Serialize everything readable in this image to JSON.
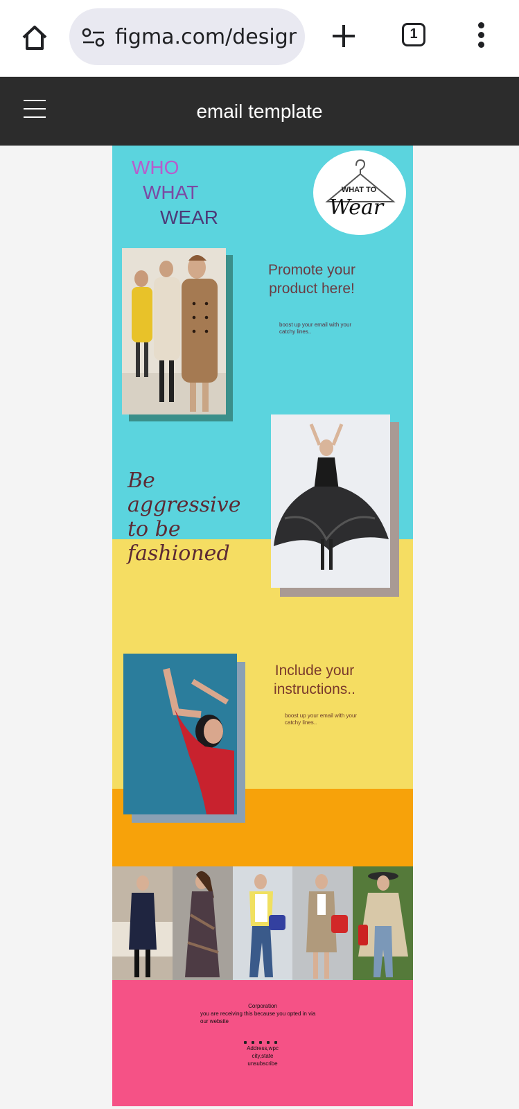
{
  "browser": {
    "url": "figma.com/design/",
    "tab_count": "1"
  },
  "figma": {
    "title": "email template"
  },
  "email": {
    "wordmark": [
      "WHO",
      "WHAT",
      "WEAR"
    ],
    "logo": {
      "line1": "WHAT TO",
      "line2": "Wear"
    },
    "promo": {
      "title": "Promote your product here!",
      "body": "boost up your  email with your catchy lines.."
    },
    "tagline": [
      "Be",
      "aggressive",
      "to be",
      "fashioned"
    ],
    "instructions": {
      "title": "Include your instructions..",
      "body": "boost up your  email with your catchy lines.."
    },
    "footer": {
      "company": "Corporation",
      "notice": "you are receiving this because you opted in via our  website",
      "address1": "Address,wpc",
      "address2": "city,state",
      "unsubscribe": "unsubscribe"
    },
    "colors": {
      "cyan": "#5bd4de",
      "yellow": "#f5dd62",
      "orange": "#f7a20a",
      "pink": "#f55286"
    }
  }
}
